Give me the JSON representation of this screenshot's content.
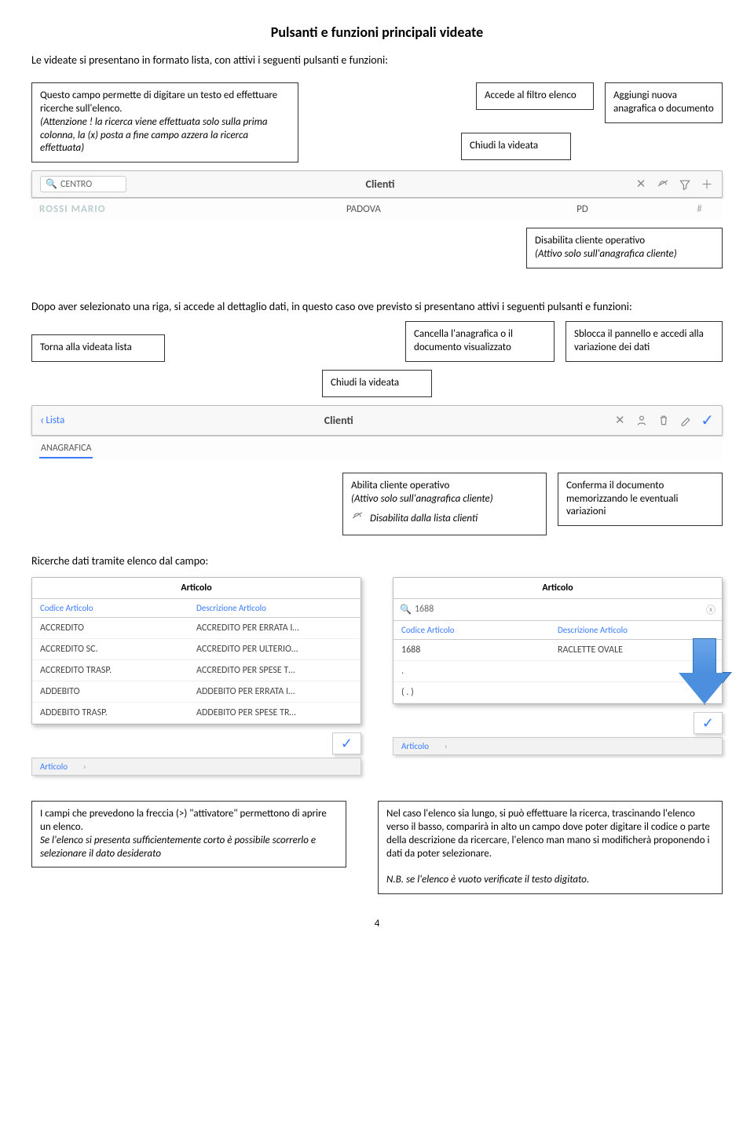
{
  "title": "Pulsanti e funzioni principali videate",
  "intro": "Le videate si presentano in formato lista, con attivi i seguenti pulsanti e funzioni:",
  "section1": {
    "box_search": "Questo campo permette di digitare un testo  ed effettuare ricerche sull'elenco.",
    "box_search_note": "(Attenzione ! la ricerca viene effettuata solo sulla prima colonna, la (x) posta a fine campo azzera la ricerca effettuata)",
    "box_filter": "Accede al filtro elenco",
    "box_close": "Chiudi la videata",
    "box_add": "Aggiungi nuova anagrafica o documento",
    "bar": {
      "search_value": "CENTRO",
      "title": "Clienti",
      "icons": {
        "close": "×",
        "link": "⊘",
        "filter": "filter",
        "plus": "+"
      }
    },
    "row": {
      "name": "ROSSI MARIO",
      "city": "PADOVA",
      "prov": "PD"
    },
    "box_disable": "Disabilita cliente operativo",
    "box_disable_note": "(Attivo solo sull'anagrafica cliente)"
  },
  "section2": {
    "para": "Dopo aver selezionato una riga, si accede al dettaglio dati, in questo caso ove previsto si presentano attivi i seguenti pulsanti e funzioni:",
    "box_back": "Torna alla videata lista",
    "box_close": "Chiudi la videata",
    "box_delete": "Cancella l'anagrafica o il documento visualizzato",
    "box_unlock": "Sblocca il pannello e accedi alla variazione dei dati",
    "bar": {
      "back_label": "Lista",
      "title": "Clienti",
      "tab": "ANAGRAFICA"
    },
    "box_enable": "Abilita cliente operativo",
    "box_enable_note": "(Attivo solo sull'anagrafica cliente)",
    "box_enable_sub": "Disabilita dalla lista clienti",
    "box_confirm": "Conferma il documento memorizzando le eventuali variazioni"
  },
  "section3": {
    "heading": "Ricerche dati tramite elenco dal campo:",
    "left_panel": {
      "title": "Articolo",
      "headers": [
        "Codice Articolo",
        "Descrizione Articolo"
      ],
      "rows": [
        [
          "ACCREDITO",
          "ACCREDITO PER ERRATA I…"
        ],
        [
          "ACCREDITO SC.",
          "ACCREDITO PER ULTERIO…"
        ],
        [
          "ACCREDITO TRASP.",
          "ACCREDITO PER SPESE T…"
        ],
        [
          "ADDEBITO",
          "ADDEBITO PER ERRATA I…"
        ],
        [
          "ADDEBITO TRASP.",
          "ADDEBITO PER SPESE TR…"
        ]
      ],
      "footer": "Articolo"
    },
    "right_panel": {
      "title": "Articolo",
      "search_value": "1688",
      "headers": [
        "Codice Articolo",
        "Descrizione Articolo"
      ],
      "rows": [
        [
          "1688",
          "RACLETTE OVALE"
        ],
        [
          ".",
          ""
        ],
        [
          "( . )",
          ""
        ]
      ],
      "footer": "Articolo"
    },
    "box_left": {
      "l1": "I campi che prevedono la freccia (>) \"attivatore\" permettono di aprire un elenco.",
      "l2": "Se l'elenco si presenta sufficientemente corto è possibile scorrerlo e selezionare il dato desiderato"
    },
    "box_right": {
      "l1": "Nel caso l'elenco sia lungo, si può effettuare la ricerca, trascinando l'elenco verso il basso, comparirà in alto un campo dove poter digitare il codice o parte della descrizione da ricercare, l'elenco man mano si modificherà proponendo i dati da poter selezionare.",
      "l2": "N.B. se l'elenco è vuoto verificate il  testo digitato."
    }
  },
  "page_number": "4"
}
